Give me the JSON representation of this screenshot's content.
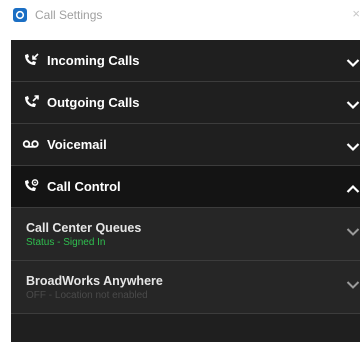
{
  "window": {
    "title": "Call Settings",
    "close_glyph": "×"
  },
  "sections": [
    {
      "label": "Incoming Calls",
      "icon": "incoming-call-icon",
      "expanded": false
    },
    {
      "label": "Outgoing Calls",
      "icon": "outgoing-call-icon",
      "expanded": false
    },
    {
      "label": "Voicemail",
      "icon": "voicemail-icon",
      "expanded": false
    },
    {
      "label": "Call Control",
      "icon": "call-control-icon",
      "expanded": true
    }
  ],
  "call_control_items": [
    {
      "label": "Call Center Queues",
      "status": "Status - Signed In",
      "status_color": "#2fbf4f"
    },
    {
      "label": "BroadWorks Anywhere",
      "status": "OFF - Location not enabled",
      "status_color": "#4a4a4a"
    }
  ],
  "colors": {
    "panel_bg": "#1f1f1f",
    "accent_icon": "#1b6fc4"
  }
}
